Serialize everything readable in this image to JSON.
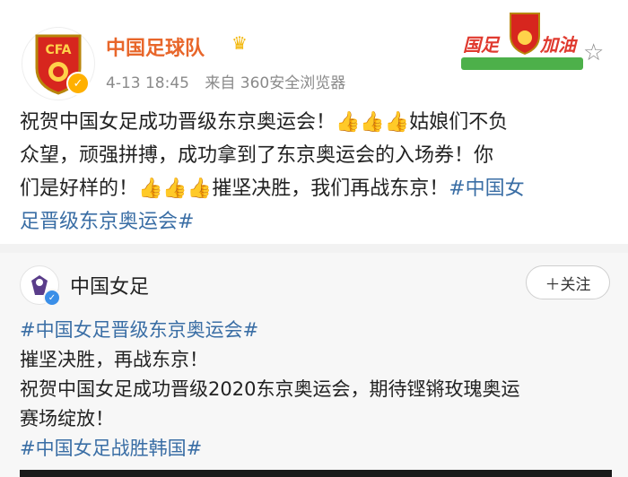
{
  "post": {
    "author": "中国足球队",
    "time": "4-13 18:45",
    "source": "来自 360安全浏览器",
    "badge_left": "国足",
    "badge_right": "加油",
    "crest_text": "CFA",
    "line1_a": "祝贺中国女足成功晋级东京奥运会！",
    "thumbs1": "👍👍👍",
    "line1_b": "姑娘们不负",
    "line2": "众望，顽强拼搏，成功拿到了东京奥运会的入场券！你",
    "line3_a": "们是好样的！",
    "thumbs2": "👍👍👍",
    "line3_b": "摧坚决胜，我们再战东京！",
    "line3_tag": "#中国女",
    "line4_tag": "足晋级东京奥运会#"
  },
  "repost": {
    "author": "中国女足",
    "follow_label": "＋关注",
    "tag1": "#中国女足晋级东京奥运会#",
    "line2": "摧坚决胜，再战东京！",
    "line3": "祝贺中国女足成功晋级2020东京奥运会，期待铿锵玫瑰奥运",
    "line4": "赛场绽放！",
    "tag2": "#中国女足战胜韩国#"
  },
  "colors": {
    "author_name": "#e8662a",
    "hashtag": "#3a6ea5",
    "verified_gold": "#ffb000",
    "verified_blue": "#3a8fe8"
  },
  "icons": [
    "cfa-crest-icon",
    "verified-icon",
    "crown-icon",
    "star-icon",
    "thumbs-up-icon"
  ]
}
